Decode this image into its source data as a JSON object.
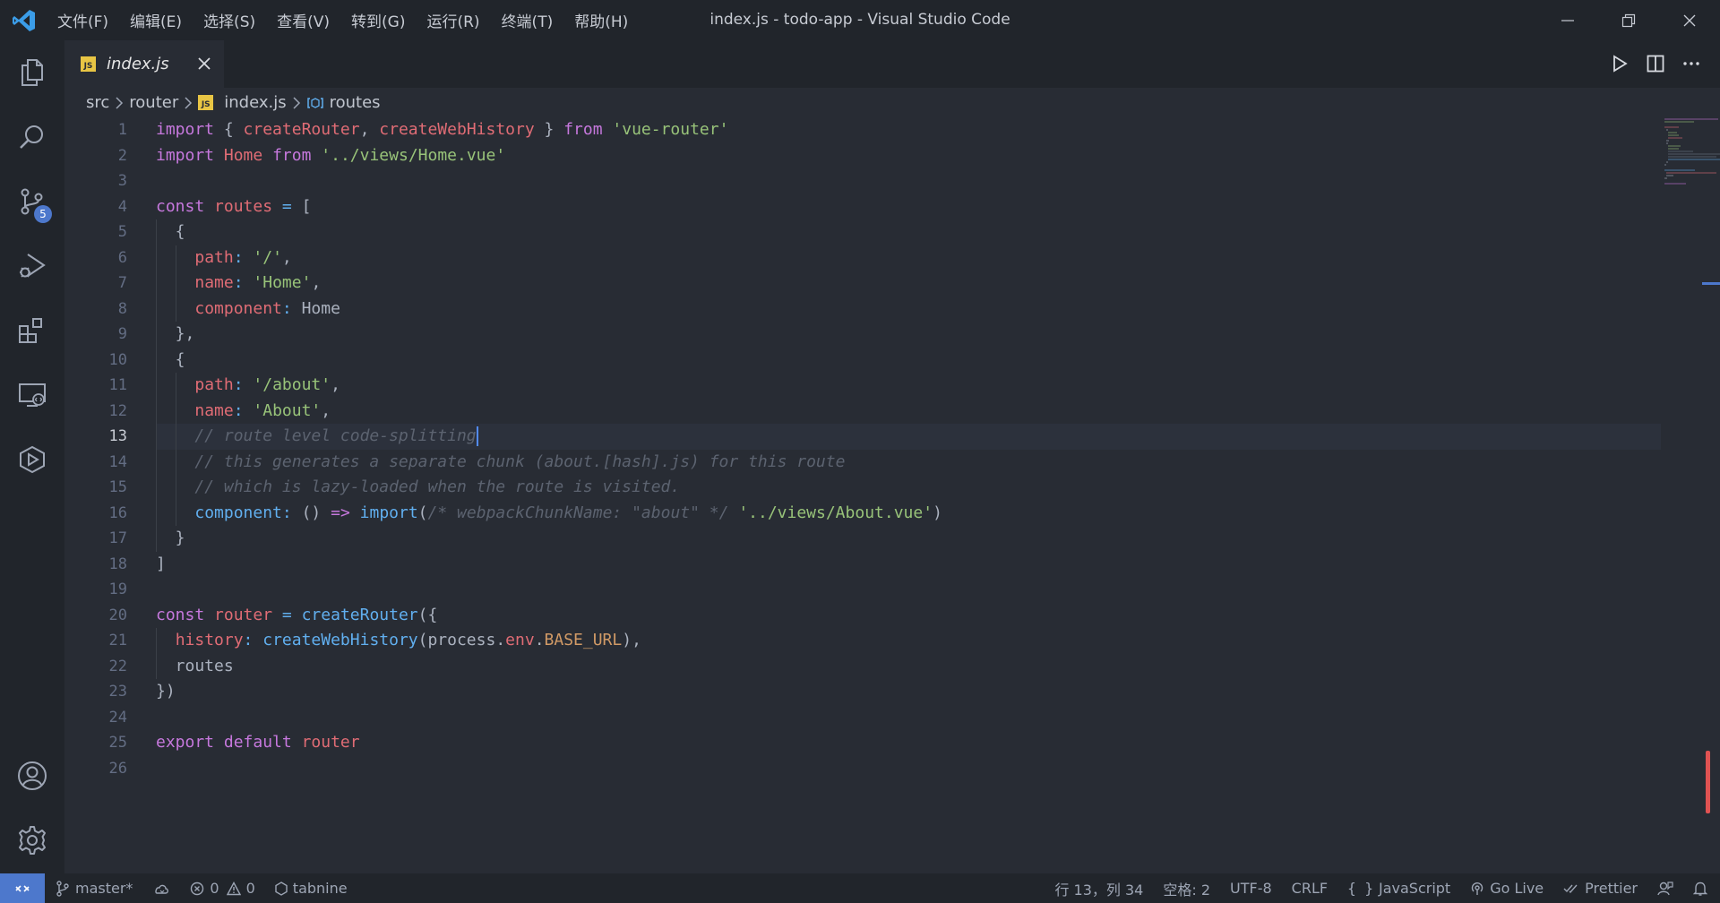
{
  "window": {
    "title": "index.js - todo-app - Visual Studio Code",
    "menu": [
      "文件(F)",
      "编辑(E)",
      "选择(S)",
      "查看(V)",
      "转到(G)",
      "运行(R)",
      "终端(T)",
      "帮助(H)"
    ]
  },
  "activity": {
    "scm_badge": "5",
    "items": [
      "explorer-icon",
      "search-icon",
      "source-control-icon",
      "run-debug-icon",
      "extensions-icon",
      "remote-explorer-icon",
      "deploy-icon",
      "account-icon",
      "gear-icon"
    ]
  },
  "tab": {
    "icon_text": "JS",
    "label": "index.js"
  },
  "breadcrumb": {
    "parts": [
      "src",
      "router",
      "index.js"
    ],
    "symbol": "routes",
    "js_icon": "JS"
  },
  "editor": {
    "current_line": 13,
    "line_numbers": [
      "1",
      "2",
      "3",
      "4",
      "5",
      "6",
      "7",
      "8",
      "9",
      "10",
      "11",
      "12",
      "13",
      "14",
      "15",
      "16",
      "17",
      "18",
      "19",
      "20",
      "21",
      "22",
      "23",
      "24",
      "25",
      "26"
    ],
    "lines": [
      [
        [
          "kw",
          "import"
        ],
        [
          "txt",
          " { "
        ],
        [
          "id",
          "createRouter"
        ],
        [
          "txt",
          ", "
        ],
        [
          "id",
          "createWebHistory"
        ],
        [
          "txt",
          " } "
        ],
        [
          "kw",
          "from"
        ],
        [
          "txt",
          " "
        ],
        [
          "str",
          "'vue-router'"
        ]
      ],
      [
        [
          "kw",
          "import"
        ],
        [
          "txt",
          " "
        ],
        [
          "id",
          "Home"
        ],
        [
          "txt",
          " "
        ],
        [
          "kw",
          "from"
        ],
        [
          "txt",
          " "
        ],
        [
          "str",
          "'../views/Home.vue'"
        ]
      ],
      [],
      [
        [
          "kw",
          "const"
        ],
        [
          "txt",
          " "
        ],
        [
          "id",
          "routes"
        ],
        [
          "txt",
          " "
        ],
        [
          "fn",
          "="
        ],
        [
          "txt",
          " ["
        ]
      ],
      [
        [
          "txt",
          "  {"
        ]
      ],
      [
        [
          "txt",
          "    "
        ],
        [
          "id",
          "path"
        ],
        [
          "fn",
          ":"
        ],
        [
          "txt",
          " "
        ],
        [
          "str",
          "'/'"
        ],
        [
          "txt",
          ","
        ]
      ],
      [
        [
          "txt",
          "    "
        ],
        [
          "id",
          "name"
        ],
        [
          "fn",
          ":"
        ],
        [
          "txt",
          " "
        ],
        [
          "str",
          "'Home'"
        ],
        [
          "txt",
          ","
        ]
      ],
      [
        [
          "txt",
          "    "
        ],
        [
          "id",
          "component"
        ],
        [
          "fn",
          ":"
        ],
        [
          "txt",
          " Home"
        ]
      ],
      [
        [
          "txt",
          "  },"
        ]
      ],
      [
        [
          "txt",
          "  {"
        ]
      ],
      [
        [
          "txt",
          "    "
        ],
        [
          "id",
          "path"
        ],
        [
          "fn",
          ":"
        ],
        [
          "txt",
          " "
        ],
        [
          "str",
          "'/about'"
        ],
        [
          "txt",
          ","
        ]
      ],
      [
        [
          "txt",
          "    "
        ],
        [
          "id",
          "name"
        ],
        [
          "fn",
          ":"
        ],
        [
          "txt",
          " "
        ],
        [
          "str",
          "'About'"
        ],
        [
          "txt",
          ","
        ]
      ],
      [
        [
          "txt",
          "    "
        ],
        [
          "com",
          "// route level code-splitting"
        ]
      ],
      [
        [
          "txt",
          "    "
        ],
        [
          "com",
          "// this generates a separate chunk (about.[hash].js) for this route"
        ]
      ],
      [
        [
          "txt",
          "    "
        ],
        [
          "com",
          "// which is lazy-loaded when the route is visited."
        ]
      ],
      [
        [
          "txt",
          "    "
        ],
        [
          "fn",
          "component"
        ],
        [
          "fn",
          ":"
        ],
        [
          "txt",
          " () "
        ],
        [
          "kw",
          "=>"
        ],
        [
          "txt",
          " "
        ],
        [
          "fn",
          "import"
        ],
        [
          "txt",
          "("
        ],
        [
          "com",
          "/* webpackChunkName: \"about\" */"
        ],
        [
          "txt",
          " "
        ],
        [
          "str",
          "'../views/About.vue'"
        ],
        [
          "txt",
          ")"
        ]
      ],
      [
        [
          "txt",
          "  }"
        ]
      ],
      [
        [
          "txt",
          "]"
        ]
      ],
      [],
      [
        [
          "kw",
          "const"
        ],
        [
          "txt",
          " "
        ],
        [
          "id",
          "router"
        ],
        [
          "txt",
          " "
        ],
        [
          "fn",
          "="
        ],
        [
          "txt",
          " "
        ],
        [
          "fn",
          "createRouter"
        ],
        [
          "txt",
          "({"
        ]
      ],
      [
        [
          "txt",
          "  "
        ],
        [
          "id",
          "history"
        ],
        [
          "fn",
          ":"
        ],
        [
          "txt",
          " "
        ],
        [
          "fn",
          "createWebHistory"
        ],
        [
          "txt",
          "(process."
        ],
        [
          "id",
          "env"
        ],
        [
          "txt",
          "."
        ],
        [
          "num",
          "BASE_URL"
        ],
        [
          "txt",
          "),"
        ]
      ],
      [
        [
          "txt",
          "  routes"
        ]
      ],
      [
        [
          "txt",
          "})"
        ]
      ],
      [],
      [
        [
          "kw",
          "export"
        ],
        [
          "txt",
          " "
        ],
        [
          "kw",
          "default"
        ],
        [
          "txt",
          " "
        ],
        [
          "id",
          "router"
        ]
      ],
      []
    ]
  },
  "status": {
    "branch": "master*",
    "errors": "0",
    "warnings": "0",
    "tabnine": "tabnine",
    "position": "行 13，列 34",
    "indent": "空格: 2",
    "encoding": "UTF-8",
    "eol": "CRLF",
    "language": "JavaScript",
    "golive": "Go Live",
    "prettier": "Prettier"
  }
}
